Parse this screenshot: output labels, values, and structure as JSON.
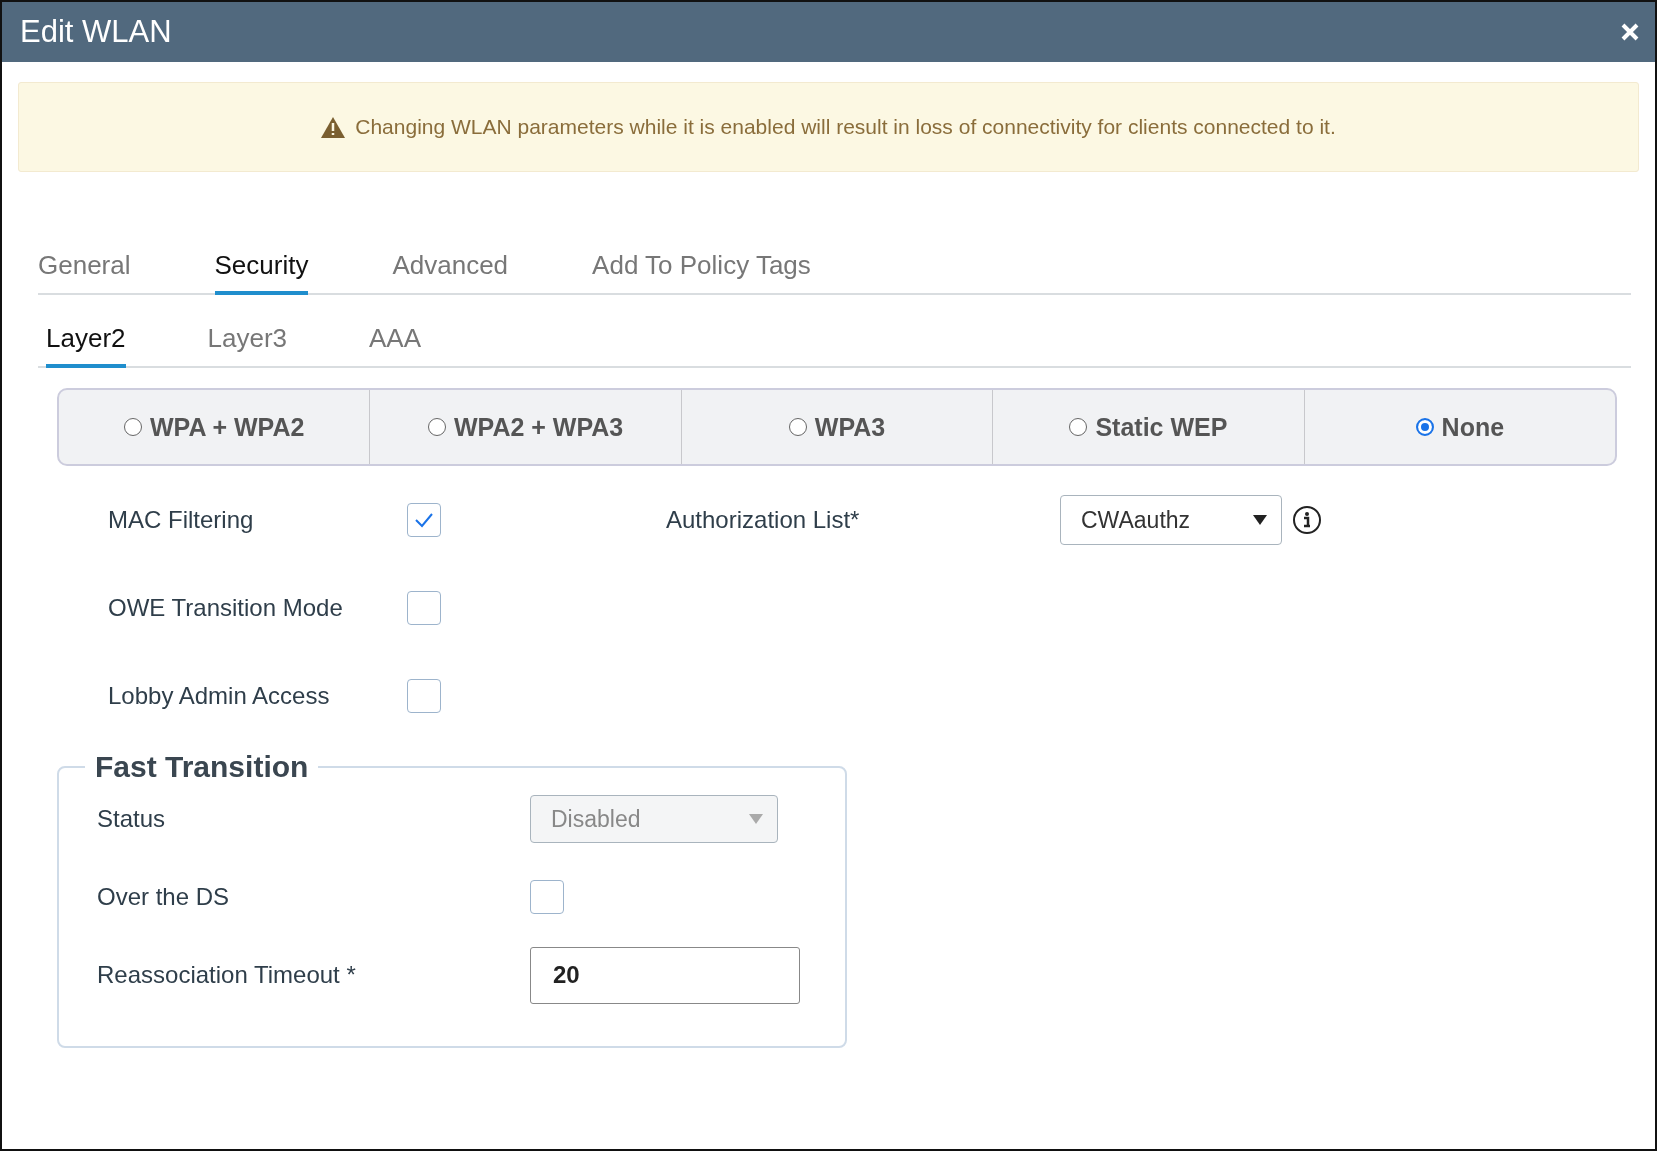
{
  "window": {
    "title": "Edit WLAN"
  },
  "alert": {
    "text": "Changing WLAN parameters while it is enabled will result in loss of connectivity for clients connected to it."
  },
  "tabs": [
    {
      "label": "General",
      "selected": false
    },
    {
      "label": "Security",
      "selected": true
    },
    {
      "label": "Advanced",
      "selected": false
    },
    {
      "label": "Add To Policy Tags",
      "selected": false
    }
  ],
  "subtabs": [
    {
      "label": "Layer2",
      "selected": true
    },
    {
      "label": "Layer3",
      "selected": false
    },
    {
      "label": "AAA",
      "selected": false
    }
  ],
  "security_modes": [
    {
      "label": "WPA + WPA2",
      "selected": false
    },
    {
      "label": "WPA2 + WPA3",
      "selected": false
    },
    {
      "label": "WPA3",
      "selected": false
    },
    {
      "label": "Static WEP",
      "selected": false
    },
    {
      "label": "None",
      "selected": true
    }
  ],
  "options": [
    {
      "label": "MAC Filtering",
      "checked": true
    },
    {
      "label": "OWE Transition Mode",
      "checked": false
    },
    {
      "label": "Lobby Admin Access",
      "checked": false
    }
  ],
  "authorization": {
    "label": "Authorization List*",
    "value": "CWAauthz"
  },
  "fast_transition": {
    "title": "Fast Transition",
    "fields": [
      {
        "kind": "select",
        "label": "Status",
        "value": "Disabled",
        "disabled": true
      },
      {
        "kind": "checkbox",
        "label": "Over the DS",
        "checked": false
      },
      {
        "kind": "input",
        "label": "Reassociation Timeout *",
        "value": "20"
      }
    ]
  }
}
